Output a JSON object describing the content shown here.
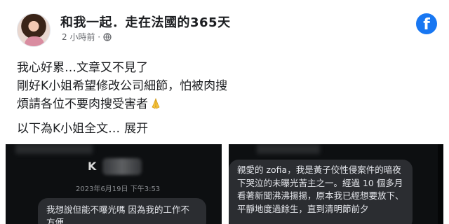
{
  "post": {
    "author": "和我一起．走在法國的365天",
    "time": "2 小時前",
    "meta_separator": "·",
    "lines": [
      "我心好累…文章又不見了",
      "剛好K小姐希望修改公司細節，怕被肉搜",
      "煩請各位不要肉搜受害者",
      "以下為K小姐全文…"
    ],
    "expand_label": "展开",
    "brand_icon": "facebook-icon",
    "brand_letter": "f",
    "emoji": "folded-hands-icon"
  },
  "screenshots": {
    "left": {
      "name_initial": "K",
      "date": "2023年6月19日 下午3:53",
      "message": "我想說但能不曝光嗎 因為我的工作不方便"
    },
    "right": {
      "message": "親愛的 zofia，我是黃子佼性侵案件的暗夜下哭泣的未曝光苦主之一。經過 10 個多月看著新聞沸沸揚揚，原本我已經想要放下、平靜地度過餘生，直到清明節前夕"
    }
  },
  "colors": {
    "facebook_blue": "#1877f2",
    "secondary_text": "#65676b",
    "bubble": "#2b2d31",
    "dark_bg": "#0d0f11"
  }
}
